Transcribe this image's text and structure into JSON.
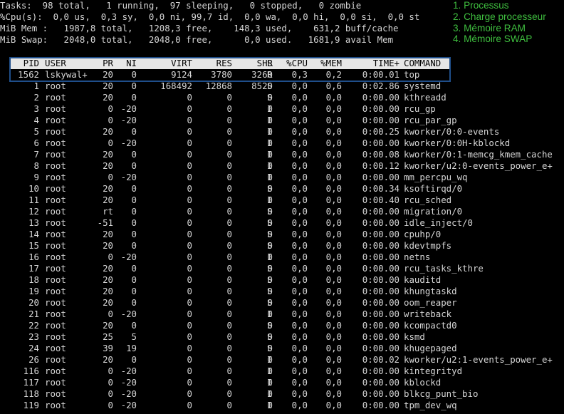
{
  "summary": [
    "Tasks:  98 total,   1 running,  97 sleeping,   0 stopped,   0 zombie",
    "%Cpu(s):  0,0 us,  0,3 sy,  0,0 ni, 99,7 id,  0,0 wa,  0,0 hi,  0,0 si,  0,0 st",
    "MiB Mem :   1987,8 total,   1208,3 free,    148,3 used,    631,2 buff/cache",
    "MiB Swap:   2048,0 total,   2048,0 free,      0,0 used.   1681,9 avail Mem"
  ],
  "legend": [
    "1. Processus",
    "2. Charge processeur",
    "3. Mémoire RAM",
    "4. Mémoire SWAP"
  ],
  "columns": [
    "PID",
    "USER",
    "PR",
    "NI",
    "VIRT",
    "RES",
    "SHR",
    "S",
    "%CPU",
    "%MEM",
    "TIME+",
    "COMMAND"
  ],
  "processes": [
    [
      "1562",
      "lskywal+",
      "20",
      "0",
      "9124",
      "3780",
      "3260",
      "R",
      "0,3",
      "0,2",
      "0:00.01",
      "top"
    ],
    [
      "1",
      "root",
      "20",
      "0",
      "168492",
      "12868",
      "8520",
      "S",
      "0,0",
      "0,6",
      "0:02.86",
      "systemd"
    ],
    [
      "2",
      "root",
      "20",
      "0",
      "0",
      "0",
      "0",
      "S",
      "0,0",
      "0,0",
      "0:00.00",
      "kthreadd"
    ],
    [
      "3",
      "root",
      "0",
      "-20",
      "0",
      "0",
      "0",
      "I",
      "0,0",
      "0,0",
      "0:00.00",
      "rcu_gp"
    ],
    [
      "4",
      "root",
      "0",
      "-20",
      "0",
      "0",
      "0",
      "I",
      "0,0",
      "0,0",
      "0:00.00",
      "rcu_par_gp"
    ],
    [
      "5",
      "root",
      "20",
      "0",
      "0",
      "0",
      "0",
      "I",
      "0,0",
      "0,0",
      "0:00.25",
      "kworker/0:0-events"
    ],
    [
      "6",
      "root",
      "0",
      "-20",
      "0",
      "0",
      "0",
      "I",
      "0,0",
      "0,0",
      "0:00.00",
      "kworker/0:0H-kblockd"
    ],
    [
      "7",
      "root",
      "20",
      "0",
      "0",
      "0",
      "0",
      "I",
      "0,0",
      "0,0",
      "0:00.08",
      "kworker/0:1-memcg_kmem_cache"
    ],
    [
      "8",
      "root",
      "20",
      "0",
      "0",
      "0",
      "0",
      "I",
      "0,0",
      "0,0",
      "0:00.12",
      "kworker/u2:0-events_power_e+"
    ],
    [
      "9",
      "root",
      "0",
      "-20",
      "0",
      "0",
      "0",
      "I",
      "0,0",
      "0,0",
      "0:00.00",
      "mm_percpu_wq"
    ],
    [
      "10",
      "root",
      "20",
      "0",
      "0",
      "0",
      "0",
      "S",
      "0,0",
      "0,0",
      "0:00.34",
      "ksoftirqd/0"
    ],
    [
      "11",
      "root",
      "20",
      "0",
      "0",
      "0",
      "0",
      "I",
      "0,0",
      "0,0",
      "0:00.40",
      "rcu_sched"
    ],
    [
      "12",
      "root",
      "rt",
      "0",
      "0",
      "0",
      "0",
      "S",
      "0,0",
      "0,0",
      "0:00.00",
      "migration/0"
    ],
    [
      "13",
      "root",
      "-51",
      "0",
      "0",
      "0",
      "0",
      "S",
      "0,0",
      "0,0",
      "0:00.00",
      "idle_inject/0"
    ],
    [
      "14",
      "root",
      "20",
      "0",
      "0",
      "0",
      "0",
      "S",
      "0,0",
      "0,0",
      "0:00.00",
      "cpuhp/0"
    ],
    [
      "15",
      "root",
      "20",
      "0",
      "0",
      "0",
      "0",
      "S",
      "0,0",
      "0,0",
      "0:00.00",
      "kdevtmpfs"
    ],
    [
      "16",
      "root",
      "0",
      "-20",
      "0",
      "0",
      "0",
      "I",
      "0,0",
      "0,0",
      "0:00.00",
      "netns"
    ],
    [
      "17",
      "root",
      "20",
      "0",
      "0",
      "0",
      "0",
      "S",
      "0,0",
      "0,0",
      "0:00.00",
      "rcu_tasks_kthre"
    ],
    [
      "18",
      "root",
      "20",
      "0",
      "0",
      "0",
      "0",
      "S",
      "0,0",
      "0,0",
      "0:00.00",
      "kauditd"
    ],
    [
      "19",
      "root",
      "20",
      "0",
      "0",
      "0",
      "0",
      "S",
      "0,0",
      "0,0",
      "0:00.00",
      "khungtaskd"
    ],
    [
      "20",
      "root",
      "20",
      "0",
      "0",
      "0",
      "0",
      "S",
      "0,0",
      "0,0",
      "0:00.00",
      "oom_reaper"
    ],
    [
      "21",
      "root",
      "0",
      "-20",
      "0",
      "0",
      "0",
      "I",
      "0,0",
      "0,0",
      "0:00.00",
      "writeback"
    ],
    [
      "22",
      "root",
      "20",
      "0",
      "0",
      "0",
      "0",
      "S",
      "0,0",
      "0,0",
      "0:00.00",
      "kcompactd0"
    ],
    [
      "23",
      "root",
      "25",
      "5",
      "0",
      "0",
      "0",
      "S",
      "0,0",
      "0,0",
      "0:00.00",
      "ksmd"
    ],
    [
      "24",
      "root",
      "39",
      "19",
      "0",
      "0",
      "0",
      "S",
      "0,0",
      "0,0",
      "0:00.00",
      "khugepaged"
    ],
    [
      "26",
      "root",
      "20",
      "0",
      "0",
      "0",
      "0",
      "I",
      "0,0",
      "0,0",
      "0:00.02",
      "kworker/u2:1-events_power_e+"
    ],
    [
      "116",
      "root",
      "0",
      "-20",
      "0",
      "0",
      "0",
      "I",
      "0,0",
      "0,0",
      "0:00.00",
      "kintegrityd"
    ],
    [
      "117",
      "root",
      "0",
      "-20",
      "0",
      "0",
      "0",
      "I",
      "0,0",
      "0,0",
      "0:00.00",
      "kblockd"
    ],
    [
      "118",
      "root",
      "0",
      "-20",
      "0",
      "0",
      "0",
      "I",
      "0,0",
      "0,0",
      "0:00.00",
      "blkcg_punt_bio"
    ],
    [
      "119",
      "root",
      "0",
      "-20",
      "0",
      "0",
      "0",
      "I",
      "0,0",
      "0,0",
      "0:00.00",
      "tpm_dev_wq"
    ]
  ],
  "colors": {
    "background": "#000000",
    "foreground": "#d6d6d6",
    "header_bg": "#e6e6e6",
    "highlight_border": "#1f4e8a",
    "legend_green": "#3fbf3f"
  }
}
